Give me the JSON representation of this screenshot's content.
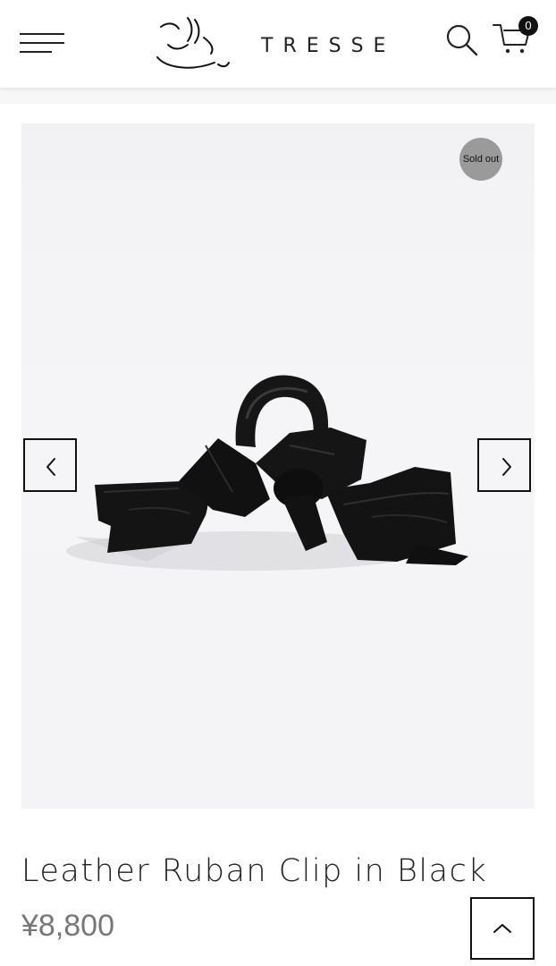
{
  "header": {
    "brand_name": "TRESSE",
    "cart_count": "0"
  },
  "product": {
    "badge": "Sold out",
    "title": "Leather Ruban Clip in Black",
    "price": "¥8,800"
  },
  "colors": {
    "text": "#222222",
    "price": "#777777",
    "badge_bg": "#9a9a9a",
    "photo_bg": "#f4f4f6"
  },
  "icons": {
    "menu": "hamburger-icon",
    "logo": "brand-logo-mark",
    "search": "search-icon",
    "cart": "cart-icon",
    "prev": "chevron-left-icon",
    "next": "chevron-right-icon",
    "top": "chevron-up-icon"
  }
}
